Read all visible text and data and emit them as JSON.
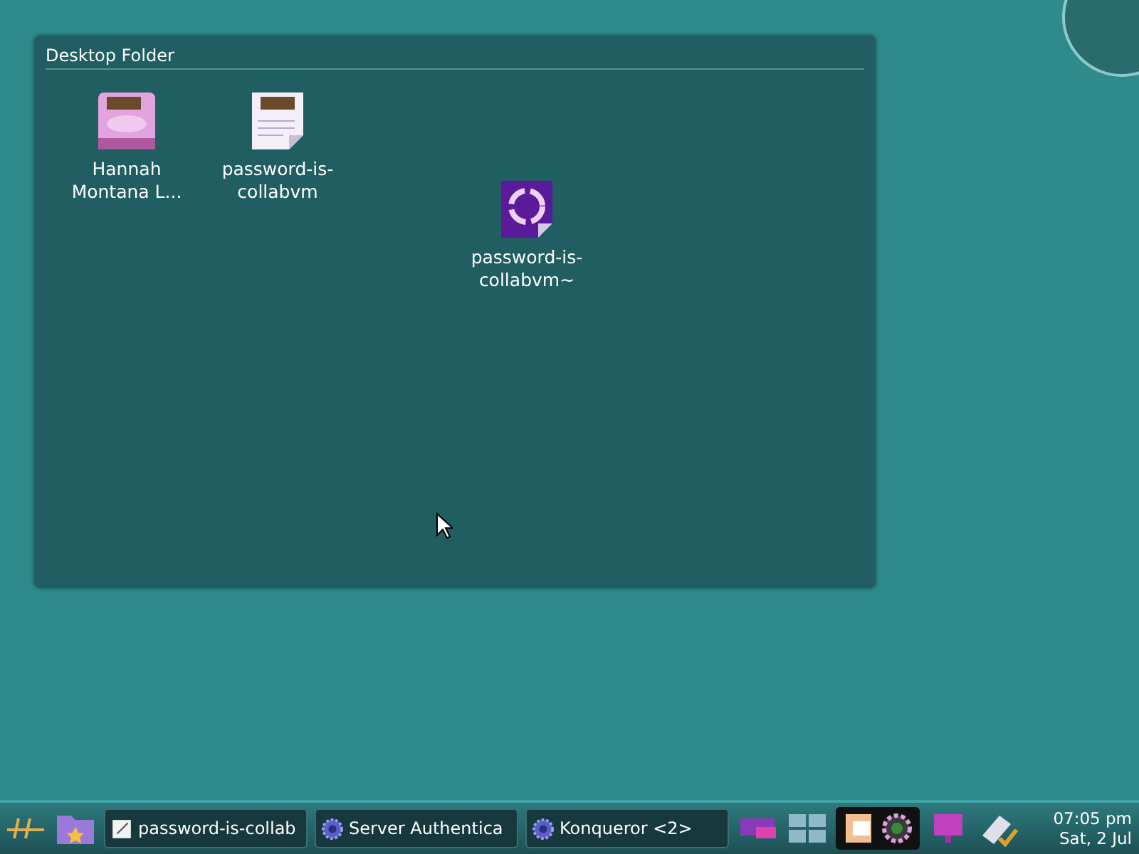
{
  "folder": {
    "title": "Desktop Folder",
    "icons": [
      {
        "kind": "drive",
        "label": "Hannah Montana L..."
      },
      {
        "kind": "document",
        "label": "password-is-collabvm"
      },
      {
        "kind": "trash",
        "label": "password-is-collabvm~"
      }
    ]
  },
  "taskbar": {
    "tasks": [
      {
        "kind": "document",
        "label": "password-is-collab"
      },
      {
        "kind": "globe",
        "label": "Server Authentica"
      },
      {
        "kind": "globe",
        "label": "Konqueror <2>"
      }
    ],
    "clock": {
      "time": "07:05 pm",
      "date": "Sat, 2 Jul"
    }
  }
}
